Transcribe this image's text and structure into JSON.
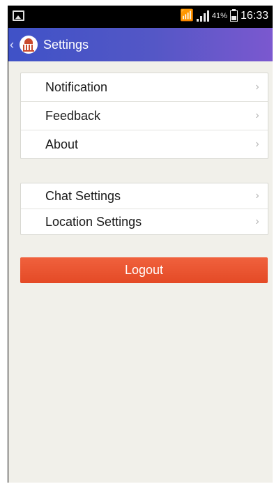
{
  "status_bar": {
    "battery_percent": "41%",
    "time": "16:33",
    "icons": [
      "gallery-icon",
      "wifi-icon",
      "signal-icon",
      "battery-icon"
    ]
  },
  "app_bar": {
    "title": "Settings",
    "back_icon": "chevron-left-icon",
    "logo_icon": "capitol-building-logo"
  },
  "settings_group_1": [
    {
      "label": "Notification",
      "icon": "chevron-right-icon"
    },
    {
      "label": "Feedback",
      "icon": "chevron-right-icon"
    },
    {
      "label": "About",
      "icon": "chevron-right-icon"
    }
  ],
  "settings_group_2": [
    {
      "label": "Chat Settings",
      "icon": "chevron-right-icon"
    },
    {
      "label": "Location Settings",
      "icon": "chevron-right-icon"
    }
  ],
  "logout": {
    "label": "Logout",
    "color": "#e9502c"
  },
  "colors": {
    "app_bar_start": "#3f52c7",
    "app_bar_end": "#7b58cf",
    "background": "#f1f0ea"
  }
}
